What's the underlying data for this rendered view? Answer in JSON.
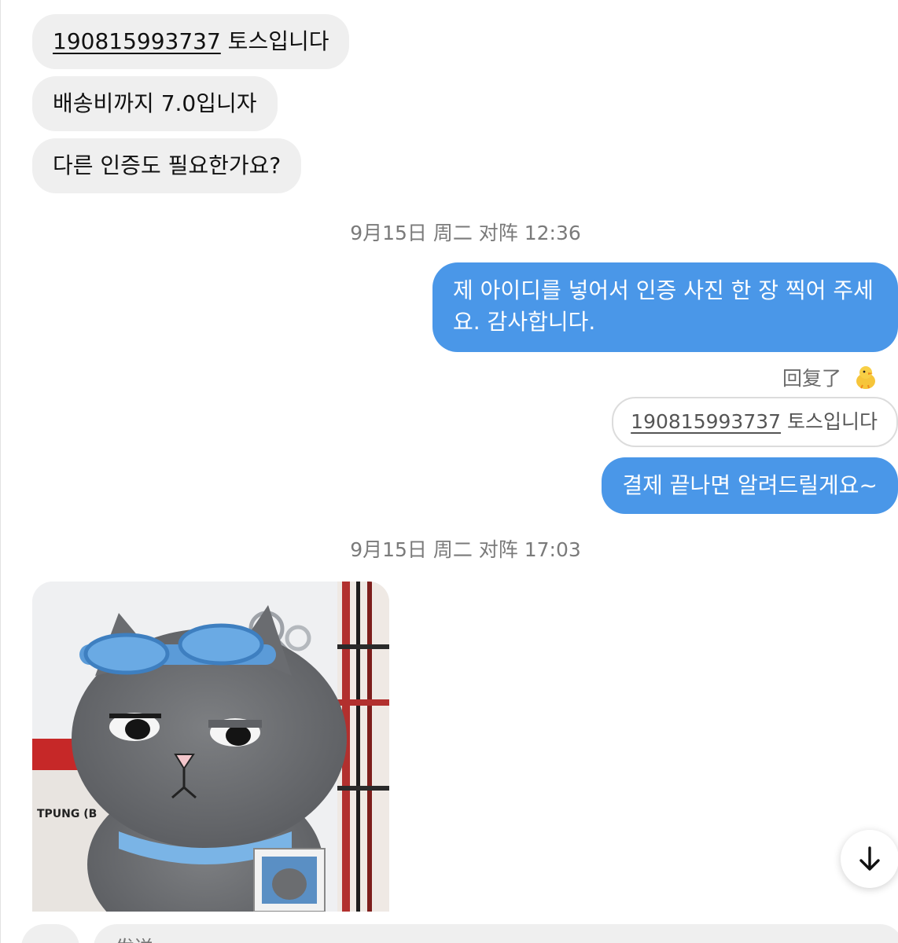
{
  "messages": {
    "m1": {
      "number": "190815993737",
      "text": " 토스입니다"
    },
    "m2": {
      "text": "배송비까지 7.0입니자"
    },
    "m3": {
      "text": "다른 인증도 필요한가요?"
    },
    "ts1": "9月15日 周二 对阵 12:36",
    "out1": {
      "line1": "제 아이디를 넣어서 인증 사진 한 장 찍어 주세",
      "line2": "요. 감사합니다."
    },
    "reply": {
      "label": "回复了",
      "icon": "chick-emoji-icon",
      "quoted_number": "190815993737",
      "quoted_text": " 토스입니다"
    },
    "out2": {
      "text": "결제 끝나면 알려드릴게요~"
    },
    "ts2": "9月15日 周二 对阵 17:03"
  },
  "photo": {
    "description_icon": "plush-cat-keychain-photo",
    "package_text": "TPUNG (B"
  },
  "scroll_button": {
    "icon": "arrow-down-icon"
  },
  "composer": {
    "placeholder": "发送..."
  },
  "colors": {
    "outgoing_bubble": "#4a97e8",
    "incoming_bubble": "#efefef",
    "timestamp": "#7a7a7a"
  }
}
